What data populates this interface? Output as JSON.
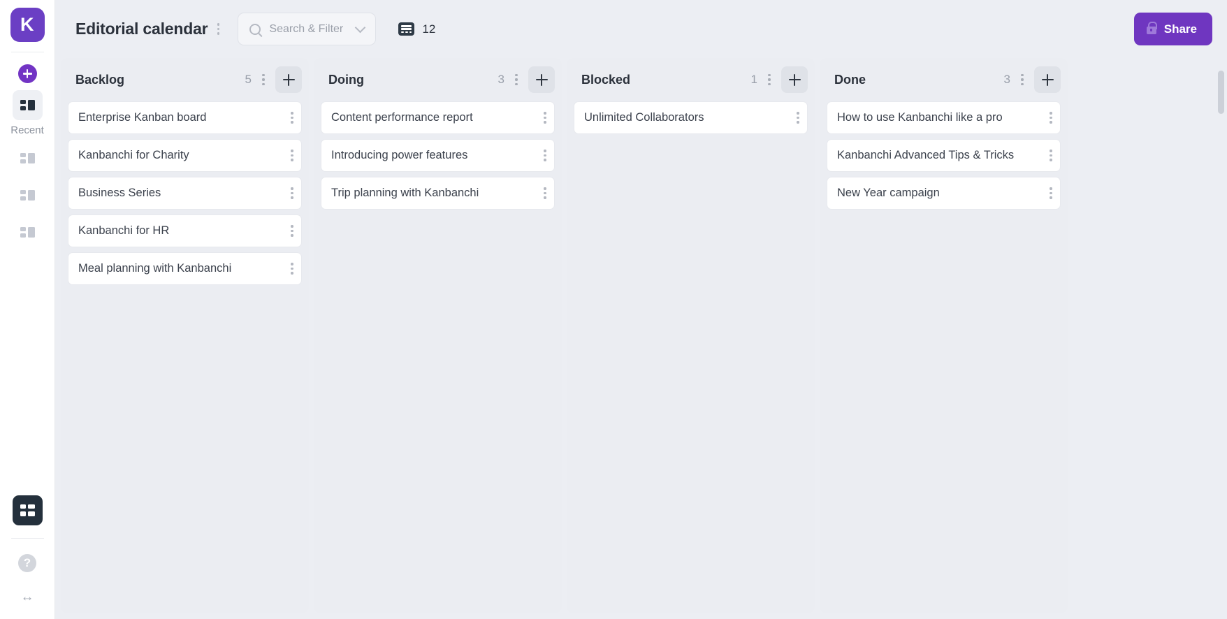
{
  "sidebar": {
    "logo_text": "K",
    "add_icon": "plus-icon",
    "recent_label": "Recent",
    "recent_boards_icon": "board-icon",
    "recent_board_count": 3,
    "workspace_icon": "grid-icon",
    "help_label": "?",
    "expand_icon": "↔"
  },
  "header": {
    "title": "Editorial calendar",
    "menu_icon": "kebab-menu-icon",
    "search": {
      "icon": "search-icon",
      "placeholder": "Search & Filter",
      "value": "",
      "chevron_icon": "chevron-down-icon"
    },
    "card_counter": {
      "icon": "card-icon",
      "count": "12"
    },
    "share": {
      "label": "Share",
      "icon": "lock-icon",
      "color": "#6f36c0"
    }
  },
  "board": {
    "columns": [
      {
        "title": "Backlog",
        "count": "5",
        "menu_icon": "kebab-menu-icon",
        "add_icon": "plus-icon",
        "cards": [
          {
            "title": "Enterprise Kanban board"
          },
          {
            "title": "Kanbanchi for Charity"
          },
          {
            "title": "Business Series"
          },
          {
            "title": "Kanbanchi for HR"
          },
          {
            "title": "Meal planning with Kanbanchi"
          }
        ]
      },
      {
        "title": "Doing",
        "count": "3",
        "menu_icon": "kebab-menu-icon",
        "add_icon": "plus-icon",
        "cards": [
          {
            "title": "Content performance report"
          },
          {
            "title": "Introducing power features"
          },
          {
            "title": "Trip planning with Kanbanchi"
          }
        ]
      },
      {
        "title": "Blocked",
        "count": "1",
        "menu_icon": "kebab-menu-icon",
        "add_icon": "plus-icon",
        "cards": [
          {
            "title": "Unlimited Collaborators"
          }
        ]
      },
      {
        "title": "Done",
        "count": "3",
        "menu_icon": "kebab-menu-icon",
        "add_icon": "plus-icon",
        "cards": [
          {
            "title": "How to use Kanbanchi like a pro"
          },
          {
            "title": "Kanbanchi Advanced Tips & Tricks"
          },
          {
            "title": "New Year campaign"
          }
        ]
      }
    ]
  },
  "colors": {
    "brand_purple": "#6f36c0",
    "board_bg": "#eceef3",
    "column_bg": "#ebedf2",
    "card_bg": "#ffffff",
    "text_dark": "#2b313b"
  }
}
